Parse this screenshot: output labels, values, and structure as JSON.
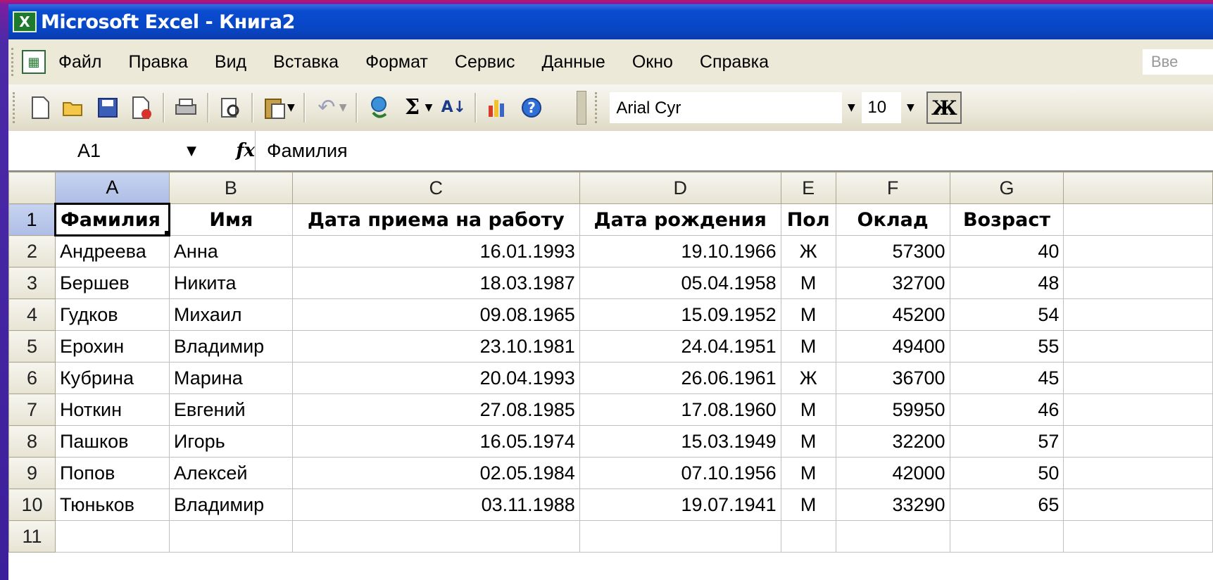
{
  "window": {
    "title": "Microsoft Excel - Книга2",
    "app_icon": "excel-icon"
  },
  "menu": {
    "items": [
      "Файл",
      "Правка",
      "Вид",
      "Вставка",
      "Формат",
      "Сервис",
      "Данные",
      "Окно",
      "Справка"
    ],
    "help_placeholder": "Вве"
  },
  "toolbar": {
    "buttons": [
      "new-icon",
      "open-icon",
      "save-icon",
      "permission-icon",
      "print-icon",
      "research-icon",
      "paste-icon",
      "undo-icon",
      "hyperlink-icon",
      "autosum-icon",
      "sort-ascending-icon",
      "chart-wizard-icon",
      "help-icon"
    ],
    "font_name": "Arial Cyr",
    "font_size": "10",
    "bold_label": "Ж"
  },
  "formula_bar": {
    "name_box": "A1",
    "fx_label": "fx",
    "value": "Фамилия"
  },
  "sheet": {
    "columns": [
      "A",
      "B",
      "C",
      "D",
      "E",
      "F",
      "G"
    ],
    "selected_column": "A",
    "selected_row": "1",
    "rows": [
      {
        "n": "1",
        "cells": [
          "Фамилия",
          "Имя",
          "Дата приема на работу",
          "Дата рождения",
          "Пол",
          "Оклад",
          "Возраст"
        ]
      },
      {
        "n": "2",
        "cells": [
          "Андреева",
          "Анна",
          "16.01.1993",
          "19.10.1966",
          "Ж",
          "57300",
          "40"
        ]
      },
      {
        "n": "3",
        "cells": [
          "Бершев",
          "Никита",
          "18.03.1987",
          "05.04.1958",
          "М",
          "32700",
          "48"
        ]
      },
      {
        "n": "4",
        "cells": [
          "Гудков",
          "Михаил",
          "09.08.1965",
          "15.09.1952",
          "М",
          "45200",
          "54"
        ]
      },
      {
        "n": "5",
        "cells": [
          "Ерохин",
          "Владимир",
          "23.10.1981",
          "24.04.1951",
          "М",
          "49400",
          "55"
        ]
      },
      {
        "n": "6",
        "cells": [
          "Кубрина",
          "Марина",
          "20.04.1993",
          "26.06.1961",
          "Ж",
          "36700",
          "45"
        ]
      },
      {
        "n": "7",
        "cells": [
          "Ноткин",
          "Евгений",
          "27.08.1985",
          "17.08.1960",
          "М",
          "59950",
          "46"
        ]
      },
      {
        "n": "8",
        "cells": [
          "Пашков",
          "Игорь",
          "16.05.1974",
          "15.03.1949",
          "М",
          "32200",
          "57"
        ]
      },
      {
        "n": "9",
        "cells": [
          "Попов",
          "Алексей",
          "02.05.1984",
          "07.10.1956",
          "М",
          "42000",
          "50"
        ]
      },
      {
        "n": "10",
        "cells": [
          "Тюньков",
          "Владимир",
          "03.11.1988",
          "19.07.1941",
          "М",
          "33290",
          "65"
        ]
      },
      {
        "n": "11",
        "cells": [
          "",
          "",
          "",
          "",
          "",
          "",
          ""
        ]
      }
    ]
  }
}
